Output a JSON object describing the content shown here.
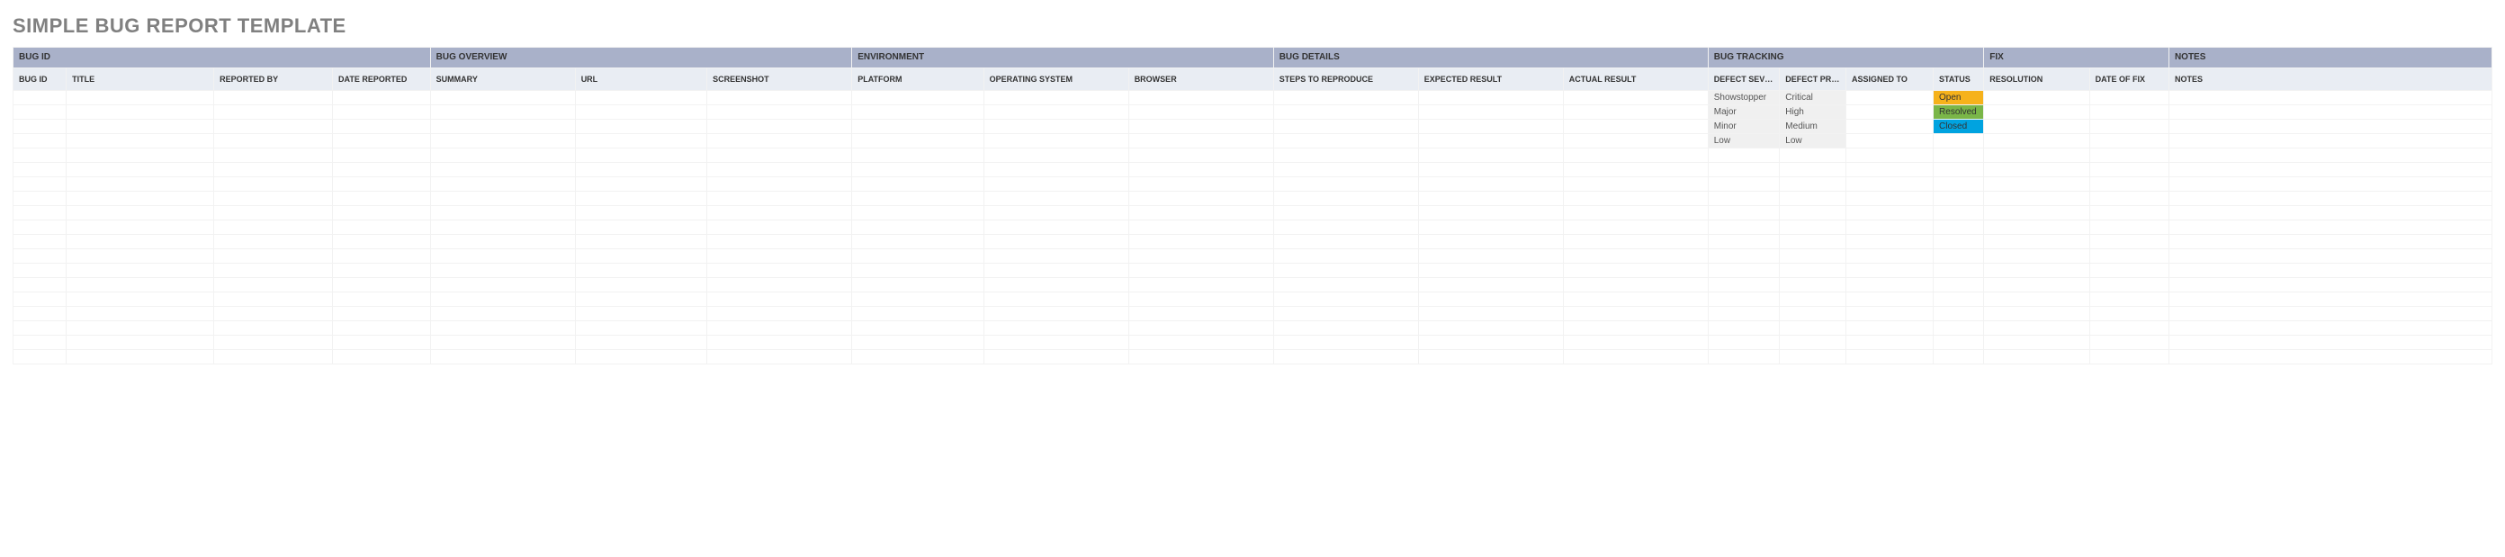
{
  "title": "SIMPLE BUG REPORT TEMPLATE",
  "groups": [
    {
      "label": "BUG ID",
      "span": 4
    },
    {
      "label": "BUG OVERVIEW",
      "span": 3
    },
    {
      "label": "ENVIRONMENT",
      "span": 3
    },
    {
      "label": "BUG DETAILS",
      "span": 3
    },
    {
      "label": "BUG TRACKING",
      "span": 4
    },
    {
      "label": "FIX",
      "span": 2
    },
    {
      "label": "NOTES",
      "span": 1
    }
  ],
  "columns": [
    "BUG ID",
    "TITLE",
    "REPORTED BY",
    "DATE REPORTED",
    "SUMMARY",
    "URL",
    "SCREENSHOT",
    "PLATFORM",
    "OPERATING SYSTEM",
    "BROWSER",
    "STEPS TO REPRODUCE",
    "EXPECTED RESULT",
    "ACTUAL RESULT",
    "DEFECT SEVERITY",
    "DEFECT PRIORITY",
    "ASSIGNED TO",
    "STATUS",
    "RESOLUTION",
    "DATE OF FIX",
    "NOTES"
  ],
  "rows": [
    {
      "severity": "Showstopper",
      "priority": "Critical",
      "status": "Open"
    },
    {
      "severity": "Major",
      "priority": "High",
      "status": "Resolved"
    },
    {
      "severity": "Minor",
      "priority": "Medium",
      "status": "Closed"
    },
    {
      "severity": "Low",
      "priority": "Low",
      "status": ""
    }
  ],
  "blank_row_count": 15,
  "status_classes": {
    "Open": "status-open",
    "Resolved": "status-resolved",
    "Closed": "status-closed"
  }
}
